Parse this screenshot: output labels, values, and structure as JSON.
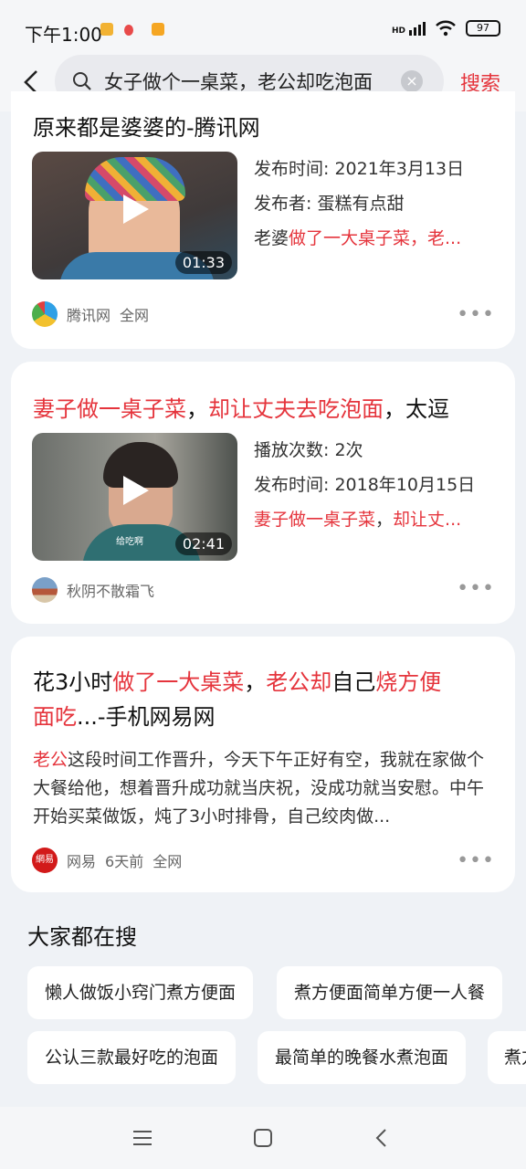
{
  "status_bar": {
    "time": "下午1:00",
    "signal": "HD",
    "battery": "97"
  },
  "search": {
    "query": "女子做个一桌菜，老公却吃泡面",
    "clear": "×",
    "button": "搜索"
  },
  "results": [
    {
      "title": "原来都是婆婆的-腾讯网",
      "duration": "01:33",
      "meta": [
        {
          "label": "发布时间:",
          "value": "2021年3月13日"
        },
        {
          "label": "发布者:",
          "value": "蛋糕有点甜"
        }
      ],
      "snippet": {
        "pre": "老婆",
        "hl": "做了一大桌子菜，老..."
      },
      "source": "腾讯网",
      "scope": "全网",
      "more": "•••"
    },
    {
      "title": {
        "hl1": "妻子做一桌子菜",
        "sep1": "，",
        "hl2": "却让丈夫去吃泡面",
        "rest": "，太逗"
      },
      "duration": "02:41",
      "watermark": "给吃啊",
      "meta": [
        {
          "label": "播放次数:",
          "value": "2次"
        },
        {
          "label": "发布时间:",
          "value": "2018年10月15日"
        }
      ],
      "snippet": {
        "hl1": "妻子做一桌子菜",
        "sep": "，",
        "hl2": "却让丈..."
      },
      "source": "秋阴不散霜飞",
      "more": "•••"
    },
    {
      "title_line1": {
        "a": "花3小时",
        "b": "做了一大桌菜",
        "c": "，",
        "d": "老公却",
        "e": "自己",
        "f": "烧方便"
      },
      "title_line2": {
        "a": "面吃",
        "b": "...-手机网易网"
      },
      "body": {
        "hl": "老公",
        "text": "这段时间工作晋升，今天下午正好有空，我就在家做个大餐给他，想着晋升成功就当庆祝，没成功就当安慰。中午开始买菜做饭，炖了3小时排骨，自己绞肉做..."
      },
      "source": "网易",
      "time": "6天前",
      "scope": "全网",
      "logo_text": "網易",
      "more": "•••"
    }
  ],
  "popular": {
    "heading": "大家都在搜",
    "row1": [
      "懒人做饭小窍门煮方便面",
      "煮方便面简单方便一人餐"
    ],
    "row2": [
      "公认三款最好吃的泡面",
      "最简单的晚餐水煮泡面",
      "煮方"
    ]
  },
  "colors": {
    "accent": "#e5343c",
    "bg": "#eff2f6",
    "card": "#ffffff"
  }
}
